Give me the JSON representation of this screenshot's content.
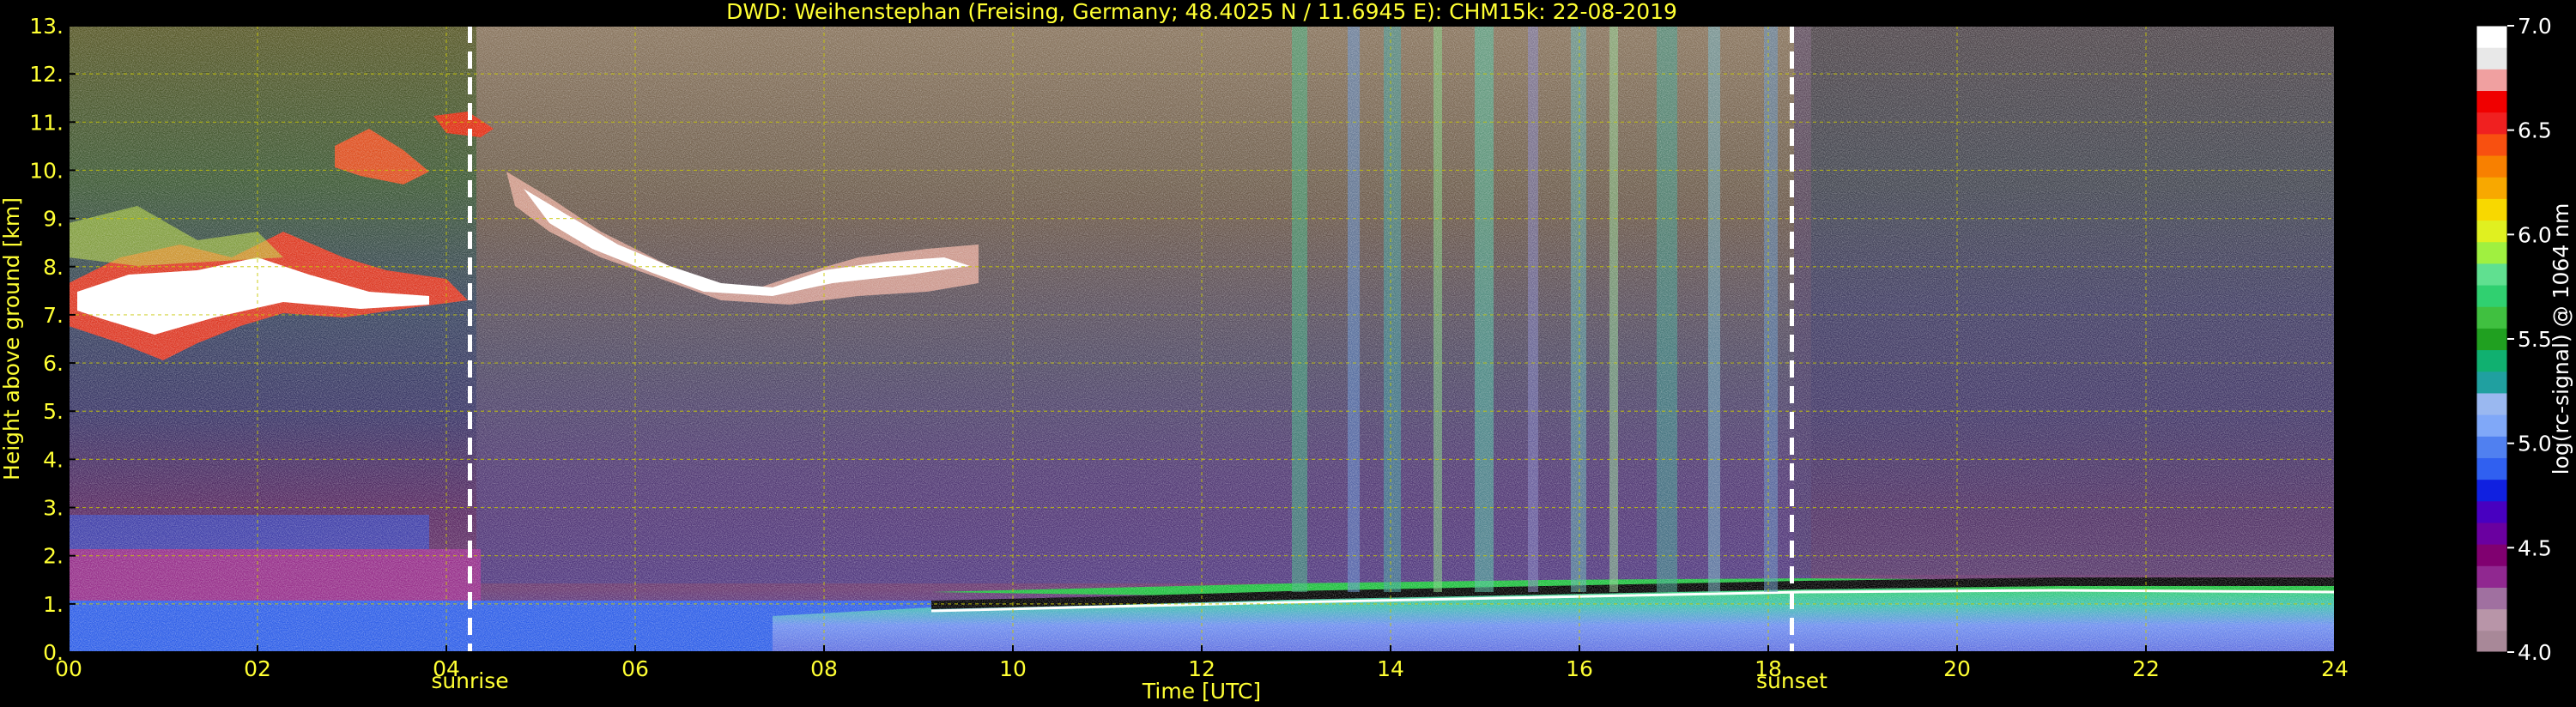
{
  "chart_data": {
    "type": "heatmap",
    "title": "DWD: Weihenstephan (Freising, Germany; 48.4025 N / 11.6945 E):    CHM15k: 22-08-2019",
    "xlabel": "Time [UTC]",
    "ylabel": "Height above ground [km]",
    "xlim": [
      0,
      24
    ],
    "ylim": [
      0,
      13
    ],
    "x_ticks": [
      "00",
      "02",
      "04",
      "06",
      "08",
      "10",
      "12",
      "14",
      "16",
      "18",
      "20",
      "22",
      "24"
    ],
    "y_ticks": [
      "0.",
      "1.",
      "2.",
      "3.",
      "4.",
      "5.",
      "6.",
      "7.",
      "8.",
      "9.",
      "10.",
      "11.",
      "12.",
      "13."
    ],
    "grid": true,
    "events": [
      {
        "label": "sunrise",
        "time": 4.25
      },
      {
        "label": "sunset",
        "time": 18.25
      }
    ],
    "colorbar": {
      "label": "log(rc-signal) @ 1064 nm",
      "range": [
        4.0,
        7.0
      ],
      "ticks": [
        "4.0",
        "4.5",
        "5.0",
        "5.5",
        "6.0",
        "6.5",
        "7.0"
      ],
      "colors": [
        "#a88898",
        "#b895a8",
        "#a070a0",
        "#902890",
        "#800070",
        "#6a00a0",
        "#4800c0",
        "#1020e0",
        "#3060f0",
        "#5080f0",
        "#80a8f8",
        "#9ab8f0",
        "#20a0a0",
        "#10b070",
        "#20a020",
        "#40c040",
        "#30d070",
        "#60e090",
        "#a0f040",
        "#e0f020",
        "#f8d800",
        "#f8a800",
        "#f88000",
        "#f85010",
        "#f02020",
        "#f00000",
        "#f0a0a0",
        "#e8e8e8",
        "#ffffff"
      ]
    }
  }
}
